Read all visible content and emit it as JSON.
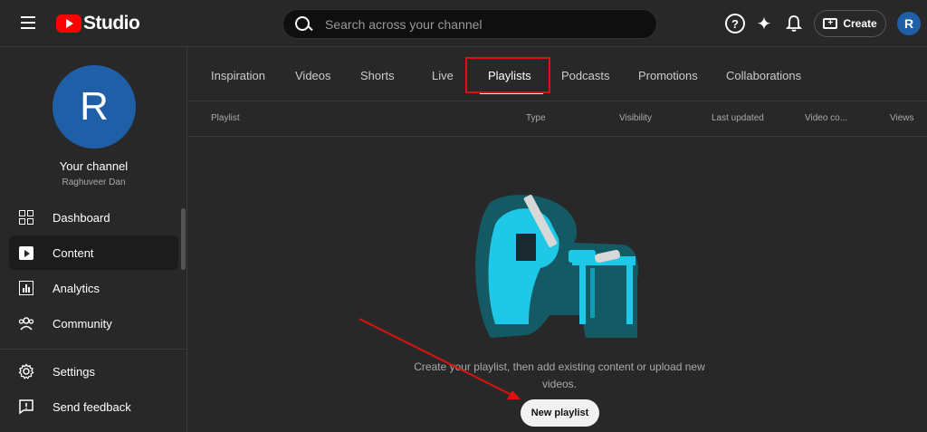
{
  "header": {
    "logo_text": "Studio",
    "search_placeholder": "Search across your channel",
    "help_icon": "?",
    "create_label": "Create",
    "avatar_letter": "R"
  },
  "sidebar": {
    "avatar_letter": "R",
    "channel_title": "Your channel",
    "channel_handle": "Raghuveer Dan",
    "items": [
      {
        "label": "Dashboard",
        "icon": "dashboard-icon"
      },
      {
        "label": "Content",
        "icon": "content-icon",
        "active": true
      },
      {
        "label": "Analytics",
        "icon": "analytics-icon"
      },
      {
        "label": "Community",
        "icon": "community-icon"
      }
    ],
    "bottom_items": [
      {
        "label": "Settings",
        "icon": "settings-icon"
      },
      {
        "label": "Send feedback",
        "icon": "feedback-icon"
      }
    ]
  },
  "tabs": [
    {
      "label": "Inspiration"
    },
    {
      "label": "Videos"
    },
    {
      "label": "Shorts"
    },
    {
      "label": "Live"
    },
    {
      "label": "Playlists",
      "active": true
    },
    {
      "label": "Podcasts"
    },
    {
      "label": "Promotions"
    },
    {
      "label": "Collaborations"
    }
  ],
  "table": {
    "columns": [
      "Playlist",
      "Type",
      "Visibility",
      "Last updated",
      "Video co...",
      "Views"
    ]
  },
  "empty_state": {
    "message": "Create your playlist, then add existing content or upload new videos.",
    "button_label": "New playlist"
  },
  "colors": {
    "background": "#282828",
    "accent_red": "#e01010",
    "avatar_blue": "#1f5fa8",
    "illustration_cyan": "#1ec8e6"
  }
}
